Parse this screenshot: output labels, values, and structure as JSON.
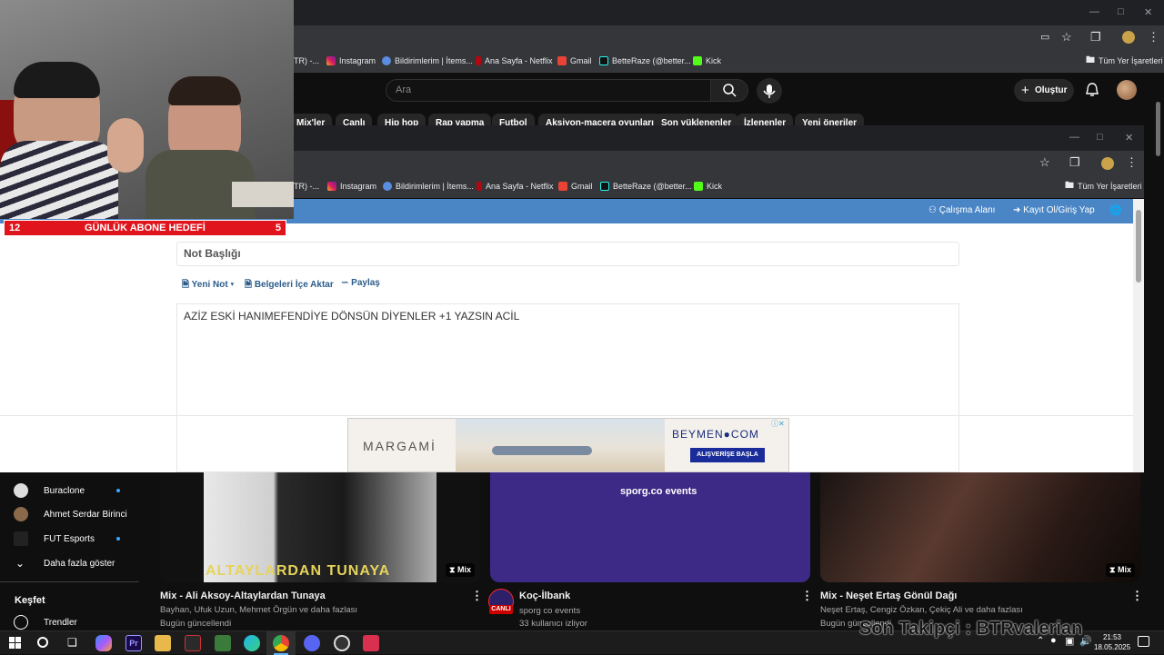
{
  "back_browser": {
    "bookmarks": [
      "Instagram",
      "Bildirimlerim | İtems...",
      "Ana Sayfa - Netflix",
      "Gmail",
      "BetteRaze (@better...",
      "Kick"
    ],
    "bookmark_partial": "TR) -...",
    "all_bookmarks": "Tüm Yer İşaretleri"
  },
  "youtube": {
    "search_placeholder": "Ara",
    "create_label": "Oluştur",
    "chips": [
      "Mix'ler",
      "Canlı",
      "Hip hop",
      "Rap yapma",
      "Futbol",
      "Aksiyon-macera oyunları",
      "Son yüklenenler",
      "İzlenenler",
      "Yeni öneriler"
    ],
    "sidebar": {
      "channels": [
        "Buraclone",
        "Ahmet Serdar Birinci",
        "FUT Esports"
      ],
      "show_more": "Daha fazla göster",
      "explore_heading": "Keşfet",
      "trending": "Trendler"
    },
    "videos": [
      {
        "title": "Mix - Ali Aksoy-Altaylardan Tunaya",
        "meta1": "Bayhan, Ufuk Uzun, Mehmet Örgün ve daha fazlası",
        "meta2": "Bugün güncellendi",
        "badge": "Mix",
        "thumb_text": "ALTAYLARDAN TUNAYA"
      },
      {
        "title": "Koç-İlbank",
        "meta1": "sporg co events",
        "meta2": "33 kullanıcı izliyor",
        "badge": "CANLI",
        "thumb_text": "sporg.co events"
      },
      {
        "title": "Mix - Neşet Ertaş Gönül Dağı",
        "meta1": "Neşet Ertaş, Cengiz Özkan, Çekiç Ali ve daha fazlası",
        "meta2": "Bugün güncellendi",
        "badge": "Mix"
      }
    ]
  },
  "front_browser": {
    "bookmarks": [
      "Instagram",
      "Bildirimlerim | İtems...",
      "Ana Sayfa - Netflix",
      "Gmail",
      "BetteRaze (@better...",
      "Kick"
    ],
    "bookmark_partial": "TR) -...",
    "all_bookmarks": "Tüm Yer İşaretleri",
    "header": {
      "workspace": "Çalışma Alanı",
      "login": "Kayıt Ol/Giriş Yap"
    },
    "note_title_placeholder": "Not Başlığı",
    "tools": {
      "new_note": "Yeni Not",
      "import_docs": "Belgeleri İçe Aktar",
      "share": "Paylaş"
    },
    "editor_text": "AZİZ ESKİ HANIMEFENDİYE DÖNSÜN DİYENLER +1 YAZSIN ACİL",
    "ad": {
      "left_brand": "MARGAMİ",
      "right_brand": "BEYMEN●COM",
      "cta": "ALIŞVERİŞE BAŞLA"
    }
  },
  "stream_overlay": {
    "goal_label": "GÜNLÜK ABONE HEDEFİ",
    "goal_current": "12",
    "goal_target": "5",
    "last_follower": "Son Takipçi : BTRvalerian"
  },
  "taskbar": {
    "time": "21:53",
    "date": "18.05.2025"
  },
  "colors": {
    "header_blue": "#4a86c5",
    "goal_red": "#e0141c",
    "link_blue": "#2b5c8a"
  }
}
